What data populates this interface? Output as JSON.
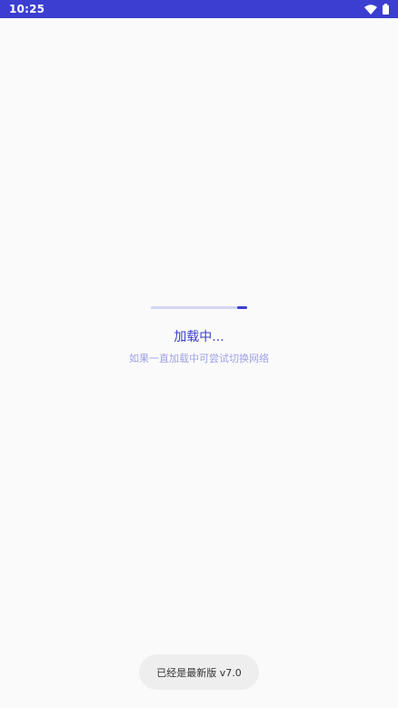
{
  "status_bar": {
    "time": "10:25",
    "icons": [
      "wifi-icon",
      "battery-icon"
    ],
    "background": "#3b3ed0"
  },
  "loading": {
    "title": "加载中...",
    "hint": "如果一直加载中可尝试切换网络",
    "progress_fraction": 0.1,
    "accent": "#3b3ed0"
  },
  "toast": {
    "message": "已经是最新版 v7.0"
  }
}
